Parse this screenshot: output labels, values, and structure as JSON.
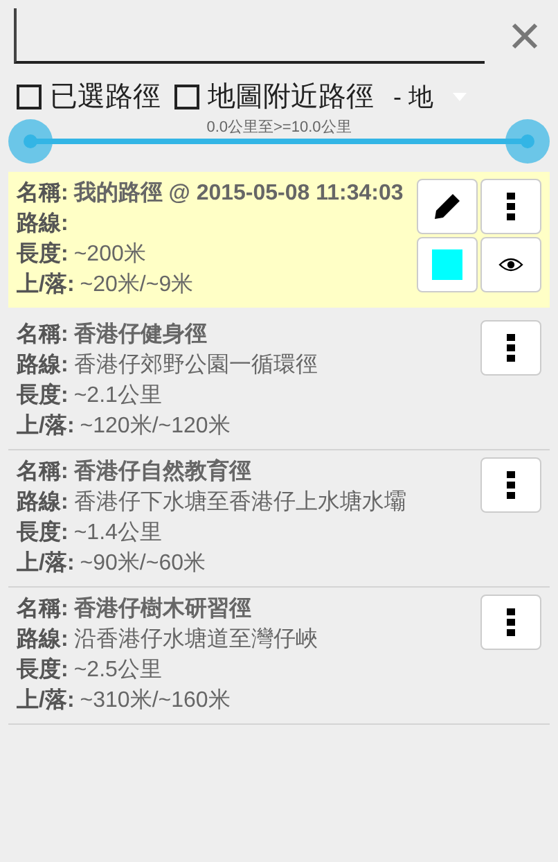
{
  "filters": [
    {
      "kind": "checkbox",
      "label": "已選路徑",
      "checked": false
    },
    {
      "kind": "checkbox",
      "label": "地圖附近路徑",
      "checked": false
    },
    {
      "kind": "dropdown",
      "label": "- 地"
    }
  ],
  "distance_slider": {
    "reading": "0.0公里至>=10.0公里"
  },
  "routes": [
    {
      "selected": true,
      "editable": true,
      "color": "#00ffff",
      "fields": [
        {
          "label": "名稱:",
          "value": "我的路徑 @ 2015-05-08 11:34:03"
        },
        {
          "label": "路線:"
        },
        {
          "label": "長度:",
          "value": "~200米"
        },
        {
          "label": "上/落:",
          "value": "~20米/~9米"
        }
      ]
    },
    {
      "selected": false,
      "editable": false,
      "fields": [
        {
          "label": "名稱:",
          "value": "香港仔健身徑"
        },
        {
          "label": "路線:",
          "value": "香港仔郊野公園一循環徑"
        },
        {
          "label": "長度:",
          "value": "~2.1公里"
        },
        {
          "label": "上/落:",
          "value": "~120米/~120米"
        }
      ]
    },
    {
      "selected": false,
      "editable": false,
      "fields": [
        {
          "label": "名稱:",
          "value": "香港仔自然教育徑"
        },
        {
          "label": "路線:",
          "value": "香港仔下水塘至香港仔上水塘水壩"
        },
        {
          "label": "長度:",
          "value": "~1.4公里"
        },
        {
          "label": "上/落:",
          "value": "~90米/~60米"
        }
      ]
    },
    {
      "selected": false,
      "editable": false,
      "fields": [
        {
          "label": "名稱:",
          "value": "香港仔樹木研習徑"
        },
        {
          "label": "路線:",
          "value": "沿香港仔水塘道至灣仔峽"
        },
        {
          "label": "長度:",
          "value": "~2.5公里"
        },
        {
          "label": "上/落:",
          "value": "~310米/~160米"
        }
      ]
    }
  ]
}
